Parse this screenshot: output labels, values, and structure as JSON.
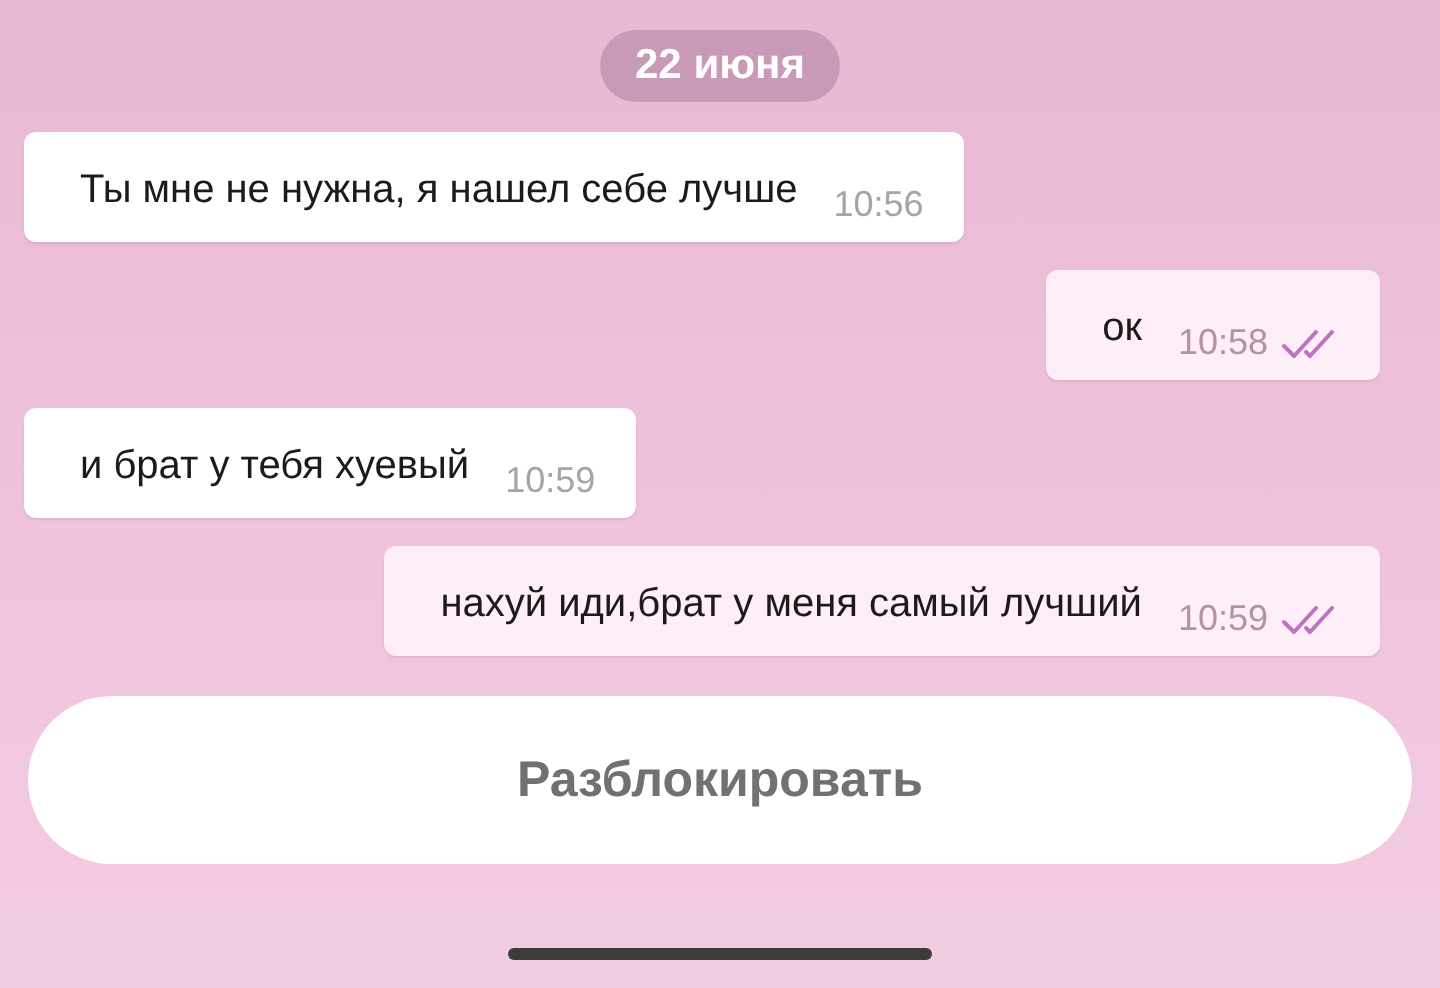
{
  "date": "22 июня",
  "messages": [
    {
      "text": "Ты мне не нужна, я нашел себе лучше",
      "time": "10:56",
      "outgoing": false
    },
    {
      "text": "ок",
      "time": "10:58",
      "outgoing": true,
      "read": true
    },
    {
      "text": "и брат у тебя хуевый",
      "time": "10:59",
      "outgoing": false
    },
    {
      "text": "нахуй иди,брат у меня самый лучший",
      "time": "10:59",
      "outgoing": true,
      "read": true
    }
  ],
  "unblock_button": "Разблокировать"
}
